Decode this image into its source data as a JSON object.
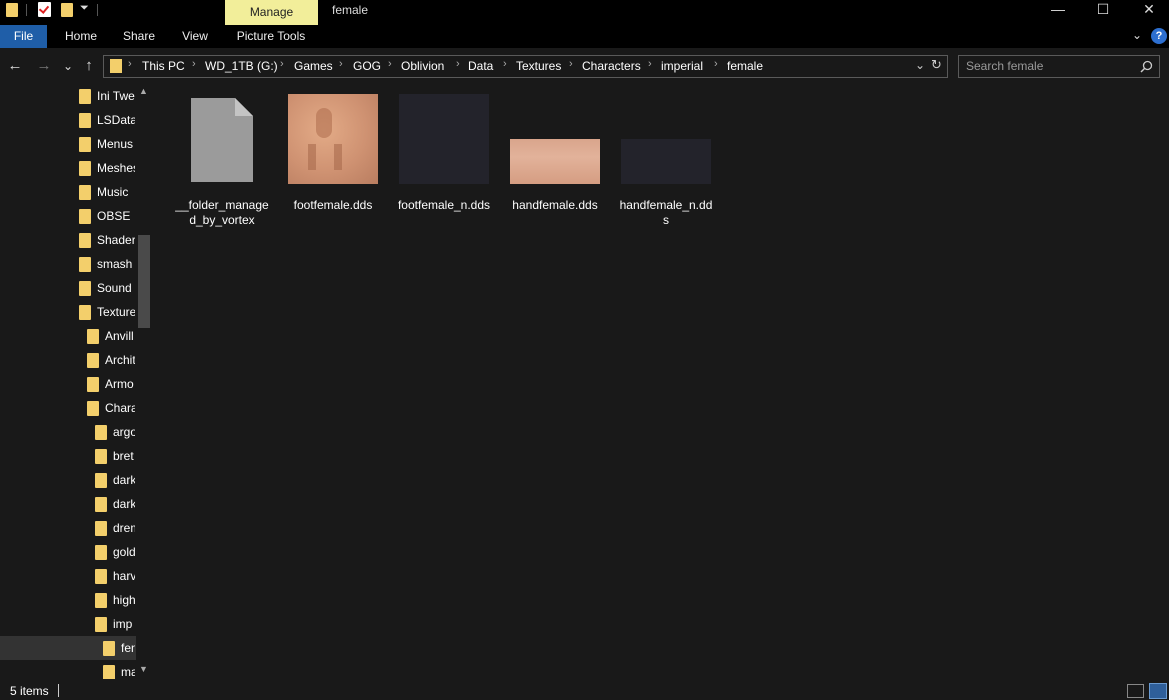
{
  "window": {
    "title": "female",
    "context_tab": "Manage",
    "minimize": "—",
    "maximize": "☐",
    "close": "✕"
  },
  "ribbon": {
    "tabs": [
      "File",
      "Home",
      "Share",
      "View",
      "Picture Tools"
    ]
  },
  "nav": {
    "back": "←",
    "forward": "→",
    "recent": "⌄",
    "up": "↑"
  },
  "address": {
    "crumbs": [
      "This PC",
      "WD_1TB (G:)",
      "Games",
      "GOG",
      "Oblivion",
      "Data",
      "Textures",
      "Characters",
      "imperial",
      "female"
    ],
    "separator": "›"
  },
  "search": {
    "placeholder": "Search female"
  },
  "tree": [
    {
      "label": "Ini Twe",
      "indent": 0
    },
    {
      "label": "LSData",
      "indent": 0
    },
    {
      "label": "Menus",
      "indent": 0
    },
    {
      "label": "Meshes",
      "indent": 0
    },
    {
      "label": "Music",
      "indent": 0
    },
    {
      "label": "OBSE",
      "indent": 0
    },
    {
      "label": "Shaders",
      "indent": 0
    },
    {
      "label": "smash",
      "indent": 0
    },
    {
      "label": "Sound",
      "indent": 0
    },
    {
      "label": "Texture",
      "indent": 0
    },
    {
      "label": "Anvill",
      "indent": 1
    },
    {
      "label": "Archit",
      "indent": 1
    },
    {
      "label": "Armo",
      "indent": 1
    },
    {
      "label": "Chara",
      "indent": 1
    },
    {
      "label": "argo",
      "indent": 2
    },
    {
      "label": "bret",
      "indent": 2
    },
    {
      "label": "dark",
      "indent": 2
    },
    {
      "label": "dark",
      "indent": 2
    },
    {
      "label": "drem",
      "indent": 2
    },
    {
      "label": "gold",
      "indent": 2
    },
    {
      "label": "harv",
      "indent": 2
    },
    {
      "label": "high",
      "indent": 2
    },
    {
      "label": "imp",
      "indent": 2
    },
    {
      "label": "fen",
      "indent": 3,
      "selected": true
    },
    {
      "label": "ma",
      "indent": 3
    }
  ],
  "files": [
    {
      "name": "__folder_managed_by_vortex",
      "kind": "generic"
    },
    {
      "name": "footfemale.dds",
      "kind": "skin-square"
    },
    {
      "name": "footfemale_n.dds",
      "kind": "dark-square"
    },
    {
      "name": "handfemale.dds",
      "kind": "skin-wide"
    },
    {
      "name": "handfemale_n.dds",
      "kind": "dark-wide"
    }
  ],
  "status": {
    "count": "5 items"
  },
  "colors": {
    "accent": "#1f5ea8",
    "manage_tab": "#f2ee9a",
    "folder": "#f3cf6b",
    "background": "#191919"
  }
}
